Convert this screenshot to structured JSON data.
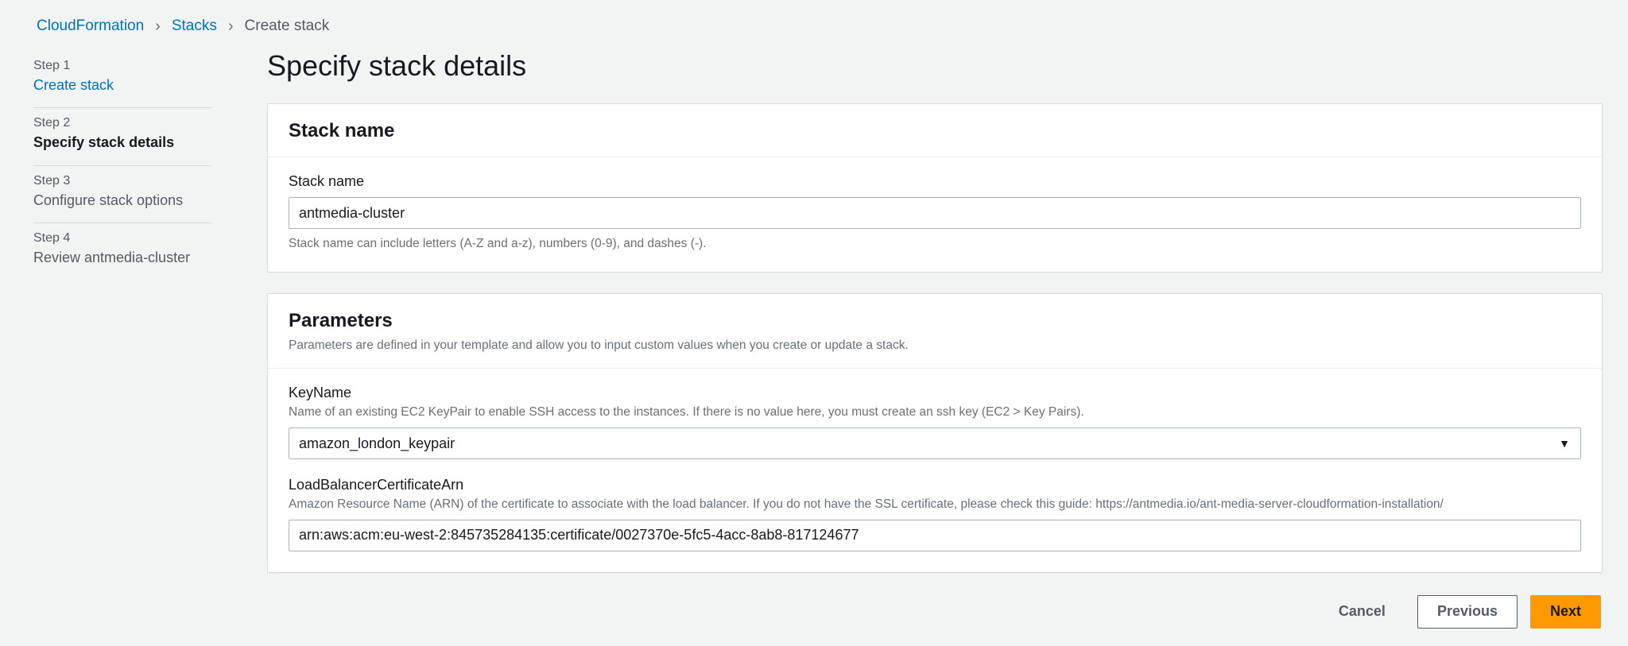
{
  "breadcrumb": {
    "items": [
      {
        "label": "CloudFormation",
        "link": true
      },
      {
        "label": "Stacks",
        "link": true
      },
      {
        "label": "Create stack",
        "link": false
      }
    ]
  },
  "wizard": {
    "steps": [
      {
        "num": "Step 1",
        "label": "Create stack",
        "state": "link"
      },
      {
        "num": "Step 2",
        "label": "Specify stack details",
        "state": "active"
      },
      {
        "num": "Step 3",
        "label": "Configure stack options",
        "state": "future"
      },
      {
        "num": "Step 4",
        "label": "Review antmedia-cluster",
        "state": "future"
      }
    ]
  },
  "page_title": "Specify stack details",
  "stack_name_panel": {
    "title": "Stack name",
    "field_label": "Stack name",
    "value": "antmedia-cluster",
    "constraint": "Stack name can include letters (A-Z and a-z), numbers (0-9), and dashes (-)."
  },
  "parameters_panel": {
    "title": "Parameters",
    "description": "Parameters are defined in your template and allow you to input custom values when you create or update a stack.",
    "key_name": {
      "label": "KeyName",
      "help": "Name of an existing EC2 KeyPair to enable SSH access to the instances. If there is no value here, you must create an ssh key (EC2 > Key Pairs).",
      "value": "amazon_london_keypair"
    },
    "lb_cert_arn": {
      "label": "LoadBalancerCertificateArn",
      "help": "Amazon Resource Name (ARN) of the certificate to associate with the load balancer. If you do not have the SSL certificate, please check this guide: https://antmedia.io/ant-media-server-cloudformation-installation/",
      "value": "arn:aws:acm:eu-west-2:845735284135:certificate/0027370e-5fc5-4acc-8ab8-817124677"
    }
  },
  "footer": {
    "cancel": "Cancel",
    "previous": "Previous",
    "next": "Next"
  }
}
